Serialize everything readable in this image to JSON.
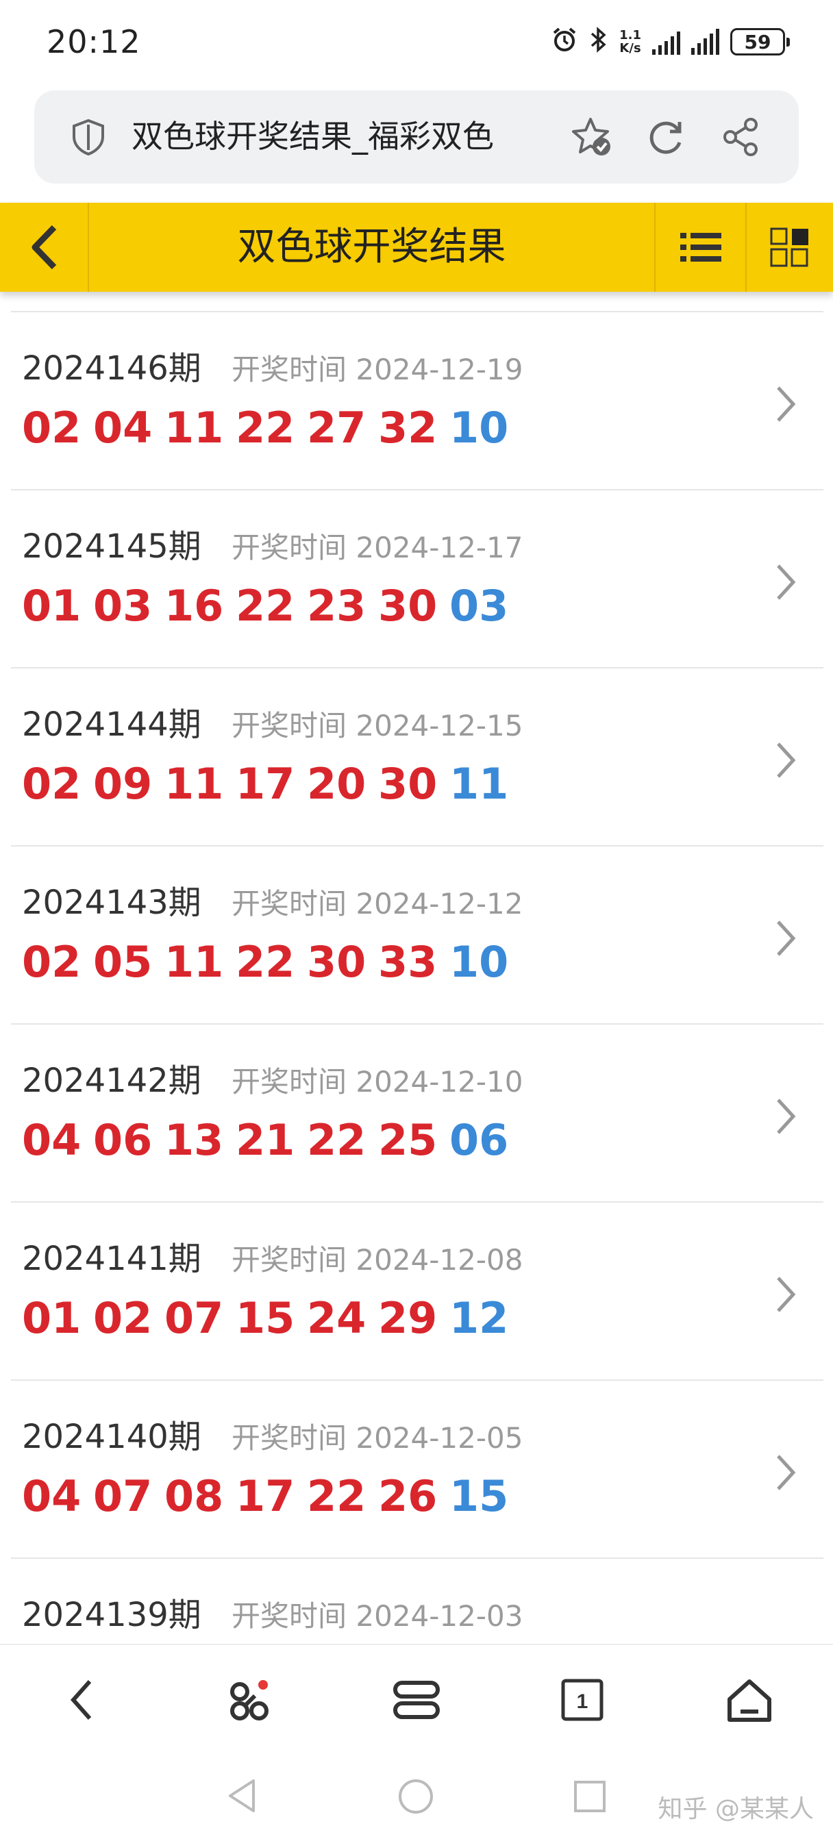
{
  "status_bar": {
    "time": "20:12",
    "net_speed_value": "1.1",
    "net_speed_unit": "K/s",
    "battery": "59",
    "icons": [
      "alarm-icon",
      "bluetooth-icon",
      "signal-icon",
      "signal-icon",
      "battery-icon"
    ]
  },
  "browser": {
    "page_title": "双色球开奖结果_福彩双色",
    "icons": [
      "shield-icon",
      "favorite-star-icon",
      "reload-icon",
      "share-icon"
    ]
  },
  "header": {
    "title": "双色球开奖结果",
    "icons": [
      "back-chevron-icon",
      "list-icon",
      "grid-icon"
    ]
  },
  "draws": [
    {
      "issue": "2024146期",
      "date_label": "开奖时间",
      "date": "2024-12-19",
      "red": [
        "02",
        "04",
        "11",
        "22",
        "27",
        "32"
      ],
      "blue": "10"
    },
    {
      "issue": "2024145期",
      "date_label": "开奖时间",
      "date": "2024-12-17",
      "red": [
        "01",
        "03",
        "16",
        "22",
        "23",
        "30"
      ],
      "blue": "03"
    },
    {
      "issue": "2024144期",
      "date_label": "开奖时间",
      "date": "2024-12-15",
      "red": [
        "02",
        "09",
        "11",
        "17",
        "20",
        "30"
      ],
      "blue": "11"
    },
    {
      "issue": "2024143期",
      "date_label": "开奖时间",
      "date": "2024-12-12",
      "red": [
        "02",
        "05",
        "11",
        "22",
        "30",
        "33"
      ],
      "blue": "10"
    },
    {
      "issue": "2024142期",
      "date_label": "开奖时间",
      "date": "2024-12-10",
      "red": [
        "04",
        "06",
        "13",
        "21",
        "22",
        "25"
      ],
      "blue": "06"
    },
    {
      "issue": "2024141期",
      "date_label": "开奖时间",
      "date": "2024-12-08",
      "red": [
        "01",
        "02",
        "07",
        "15",
        "24",
        "29"
      ],
      "blue": "12"
    },
    {
      "issue": "2024140期",
      "date_label": "开奖时间",
      "date": "2024-12-05",
      "red": [
        "04",
        "07",
        "08",
        "17",
        "22",
        "26"
      ],
      "blue": "15"
    },
    {
      "issue": "2024139期",
      "date_label": "开奖时间",
      "date": "2024-12-03",
      "red": [],
      "blue": ""
    }
  ],
  "bottom_nav": {
    "tab_count": "1",
    "icons": [
      "back-icon",
      "features-icon",
      "menu-icon",
      "tabs-icon",
      "home-icon"
    ]
  },
  "watermark": "知乎 @某某人",
  "colors": {
    "header_bg": "#f7cc00",
    "red_ball": "#d9262c",
    "blue_ball": "#3a8ad8",
    "date_gray": "#9a9a9a"
  }
}
